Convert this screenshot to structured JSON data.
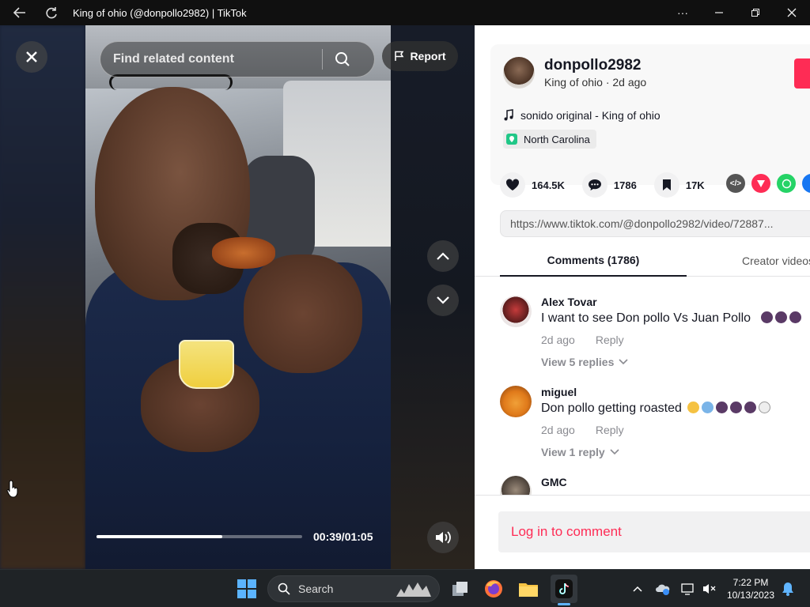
{
  "window": {
    "title": "King of ohio (@donpollo2982) | TikTok",
    "back_icon": "back-arrow-icon",
    "refresh_icon": "refresh-icon",
    "controls": [
      "more-icon",
      "minimize-icon",
      "maximize-icon",
      "close-icon"
    ]
  },
  "player": {
    "search_placeholder": "Find related content",
    "report_label": "Report",
    "elapsed": "00:39/01:05",
    "progress_fraction": 0.61
  },
  "author": {
    "username": "donpollo2982",
    "nickname": "King of ohio",
    "posted": "2d ago",
    "subline": "King of ohio · 2d ago",
    "music": "sonido original - King of ohio",
    "location": "North Carolina"
  },
  "stats": {
    "likes": "164.5K",
    "comments": "1786",
    "saves": "17K"
  },
  "link": "https://www.tiktok.com/@donpollo2982/video/72887...",
  "tabs": {
    "comments": "Comments (1786)",
    "creator": "Creator videos"
  },
  "comments": [
    {
      "name": "Alex Tovar",
      "text": "I want to see Don pollo Vs Juan Pollo",
      "time": "2d ago",
      "reply": "Reply",
      "replies": "View 5 replies"
    },
    {
      "name": "miguel",
      "text": "Don pollo getting roasted",
      "time": "2d ago",
      "reply": "Reply",
      "replies": "View 1 reply"
    },
    {
      "name": "GMC",
      "text": "",
      "time": "",
      "reply": "",
      "replies": ""
    }
  ],
  "login_label": "Log in to comment",
  "taskbar": {
    "search_label": "Search",
    "time": "7:22 PM",
    "date": "10/13/2023"
  },
  "colors": {
    "accent": "#fe2c55",
    "taskbar": "#1f2326",
    "titlebar": "#101010"
  }
}
